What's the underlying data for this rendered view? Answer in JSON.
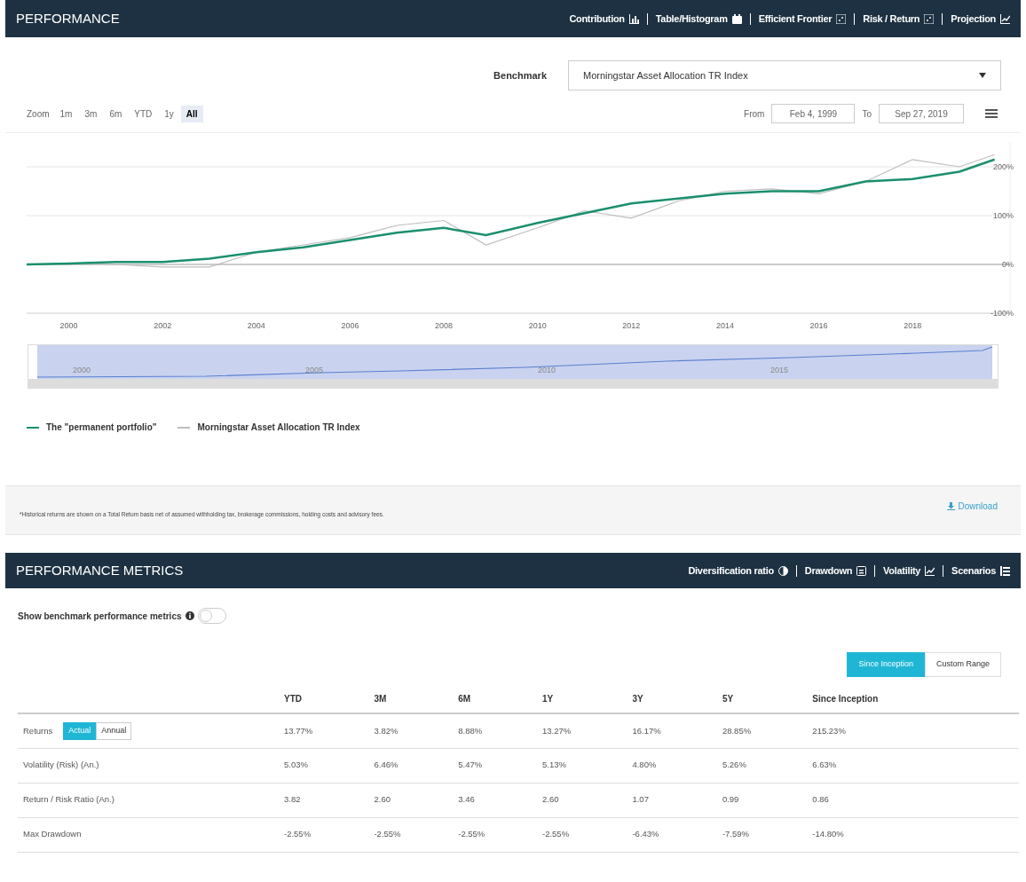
{
  "performance": {
    "title": "PERFORMANCE",
    "nav": [
      {
        "label": "Contribution",
        "kind": "bar"
      },
      {
        "label": "Table/Histogram",
        "kind": "calendar"
      },
      {
        "label": "Efficient Frontier",
        "kind": "scatter"
      },
      {
        "label": "Risk / Return",
        "kind": "scatter"
      },
      {
        "label": "Projection",
        "kind": "line"
      }
    ],
    "benchmark": {
      "label": "Benchmark",
      "value": "Morningstar Asset Allocation TR Index"
    },
    "zoom": {
      "label": "Zoom",
      "buttons": [
        {
          "label": "1m",
          "selected": false
        },
        {
          "label": "3m",
          "selected": false
        },
        {
          "label": "6m",
          "selected": false
        },
        {
          "label": "YTD",
          "selected": false
        },
        {
          "label": "1y",
          "selected": false
        },
        {
          "label": "All",
          "selected": true
        }
      ]
    },
    "range": {
      "from_label": "From",
      "from": "Feb 4, 1999",
      "to_label": "To",
      "to": "Sep 27, 2019"
    },
    "chart_data": {
      "type": "line",
      "x": [
        1999.1,
        2000,
        2001,
        2002,
        2003,
        2004,
        2005,
        2006,
        2007,
        2008,
        2008.9,
        2010,
        2011,
        2012,
        2013,
        2014,
        2015,
        2016,
        2017,
        2018,
        2019,
        2019.75
      ],
      "xticks": [
        {
          "value": 2000,
          "label": "2000"
        },
        {
          "value": 2002,
          "label": "2002"
        },
        {
          "value": 2004,
          "label": "2004"
        },
        {
          "value": 2006,
          "label": "2006"
        },
        {
          "value": 2008,
          "label": "2008"
        },
        {
          "value": 2010,
          "label": "2010"
        },
        {
          "value": 2012,
          "label": "2012"
        },
        {
          "value": 2014,
          "label": "2014"
        },
        {
          "value": 2016,
          "label": "2016"
        },
        {
          "value": 2018,
          "label": "2018"
        }
      ],
      "xlim": [
        1999.1,
        2020.08
      ],
      "ylim": [
        -100,
        250
      ],
      "yticks": [
        {
          "value": -100,
          "label": "-100%"
        },
        {
          "value": 0,
          "label": "0%"
        },
        {
          "value": 100,
          "label": "100%"
        },
        {
          "value": 200,
          "label": "200%"
        }
      ],
      "series": [
        {
          "name": "The \"permanent portfolio\"",
          "color": "#1a8f6e",
          "values": [
            0,
            2,
            5,
            5,
            12,
            25,
            35,
            50,
            65,
            75,
            60,
            85,
            105,
            125,
            135,
            145,
            150,
            150,
            170,
            175,
            190,
            215
          ]
        },
        {
          "name": "Morningstar Asset Allocation TR Index",
          "color": "#bdbdbd",
          "values": [
            0,
            2,
            0,
            -5,
            -5,
            25,
            40,
            55,
            80,
            90,
            40,
            75,
            110,
            95,
            130,
            150,
            155,
            145,
            170,
            215,
            200,
            225
          ]
        }
      ]
    },
    "navigator": {
      "labels": [
        "2000",
        "2005",
        "2010",
        "2015"
      ]
    },
    "footnote": "*Historical returns are shown on a Total Return basis net of assumed withholding tax, brokerage commissions, holding costs and advisory fees.",
    "download": "Download"
  },
  "metrics": {
    "title": "PERFORMANCE METRICS",
    "nav": [
      {
        "label": "Diversification ratio",
        "kind": "halfcircle"
      },
      {
        "label": "Drawdown",
        "kind": "box"
      },
      {
        "label": "Volatility",
        "kind": "line"
      },
      {
        "label": "Scenarios",
        "kind": "list"
      }
    ],
    "benchmark_toggle": {
      "label": "Show benchmark performance metrics",
      "on": false
    },
    "ranges": [
      {
        "label": "Since Inception",
        "selected": true
      },
      {
        "label": "Custom Range",
        "selected": false
      }
    ],
    "columns": [
      "YTD",
      "3M",
      "6M",
      "1Y",
      "3Y",
      "5Y",
      "Since Inception"
    ],
    "rows": [
      {
        "label": "Returns",
        "modes": [
          {
            "label": "Actual",
            "selected": true
          },
          {
            "label": "Annual",
            "selected": false
          }
        ],
        "values": [
          "13.77%",
          "3.82%",
          "8.88%",
          "13.27%",
          "16.17%",
          "28.85%",
          "215.23%"
        ]
      },
      {
        "label": "Volatility (Risk) (An.)",
        "values": [
          "5.03%",
          "6.46%",
          "5.47%",
          "5.13%",
          "4.80%",
          "5.26%",
          "6.63%"
        ]
      },
      {
        "label": "Return / Risk Ratio (An.)",
        "values": [
          "3.82",
          "2.60",
          "3.46",
          "2.60",
          "1.07",
          "0.99",
          "0.86"
        ]
      },
      {
        "label": "Max Drawdown",
        "values": [
          "-2.55%",
          "-2.55%",
          "-2.55%",
          "-2.55%",
          "-6.43%",
          "-7.59%",
          "-14.80%"
        ]
      }
    ]
  }
}
